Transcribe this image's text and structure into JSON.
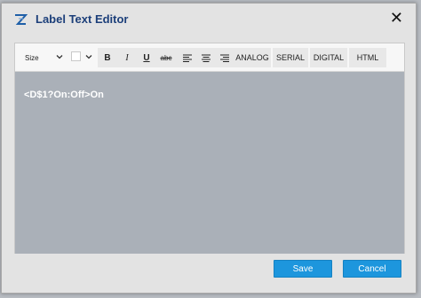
{
  "dialog": {
    "title": "Label Text Editor",
    "close_glyph": "✕",
    "logo_icon": "z-logo-icon"
  },
  "toolbar": {
    "size_label": "Size",
    "bold": "B",
    "italic": "I",
    "underline": "U",
    "strike": "abc",
    "analog": "ANALOG",
    "serial": "SERIAL",
    "digital": "DIGITAL",
    "html": "HTML"
  },
  "editor": {
    "content": "<D$1?On:Off>On"
  },
  "buttons": {
    "save": "Save",
    "cancel": "Cancel"
  },
  "colors": {
    "title": "#1c3f7a",
    "editor_bg": "#aab0b8",
    "primary_button": "#1d96dd"
  }
}
